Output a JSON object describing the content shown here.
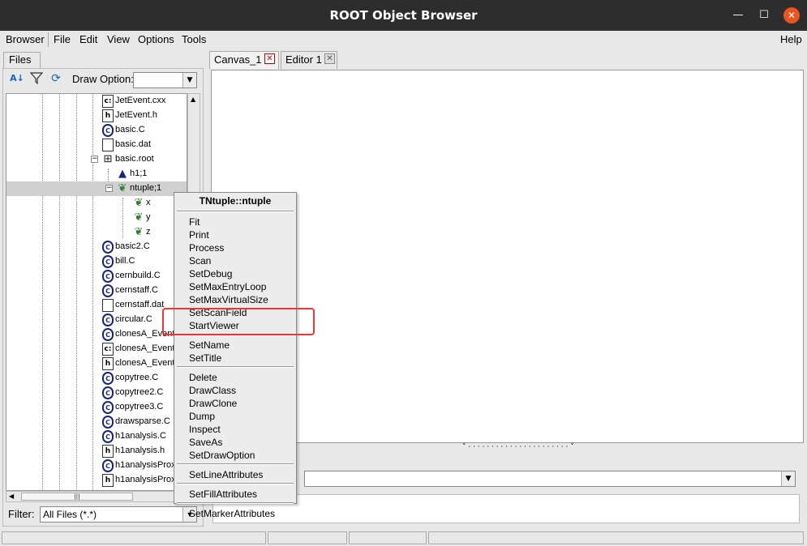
{
  "window": {
    "title": "ROOT Object Browser",
    "min_glyph": "—",
    "max_glyph": "☐",
    "close_glyph": "✕"
  },
  "menubar": {
    "browser": "Browser",
    "file": "File",
    "edit": "Edit",
    "view": "View",
    "options": "Options",
    "tools": "Tools",
    "help": "Help"
  },
  "left": {
    "tab_files": "Files",
    "draw_option_label": "Draw Option:",
    "draw_option_value": "",
    "filter_label": "Filter:",
    "filter_value": "All Files (*.*)",
    "tree": [
      {
        "label": "JetEvent.cxx",
        "icon": "c-source-icon",
        "glyph": "c:"
      },
      {
        "label": "JetEvent.h",
        "icon": "header-file-icon",
        "glyph": "h"
      },
      {
        "label": "basic.C",
        "icon": "macro-file-icon",
        "glyph": "C"
      },
      {
        "label": "basic.dat",
        "icon": "text-file-icon",
        "glyph": ""
      },
      {
        "label": "basic.root",
        "icon": "root-file-icon",
        "glyph": "⊞"
      },
      {
        "label": "h1;1",
        "icon": "histogram-icon",
        "glyph": "▲"
      },
      {
        "label": "ntuple;1",
        "icon": "ntuple-icon",
        "glyph": "❦"
      },
      {
        "label": "x",
        "icon": "leaf-icon",
        "glyph": "❦"
      },
      {
        "label": "y",
        "icon": "leaf-icon",
        "glyph": "❦"
      },
      {
        "label": "z",
        "icon": "leaf-icon",
        "glyph": "❦"
      },
      {
        "label": "basic2.C",
        "icon": "macro-file-icon",
        "glyph": "C"
      },
      {
        "label": "bill.C",
        "icon": "macro-file-icon",
        "glyph": "C"
      },
      {
        "label": "cernbuild.C",
        "icon": "macro-file-icon",
        "glyph": "C"
      },
      {
        "label": "cernstaff.C",
        "icon": "macro-file-icon",
        "glyph": "C"
      },
      {
        "label": "cernstaff.dat",
        "icon": "text-file-icon",
        "glyph": ""
      },
      {
        "label": "circular.C",
        "icon": "macro-file-icon",
        "glyph": "C"
      },
      {
        "label": "clonesA_Event",
        "icon": "macro-file-icon",
        "glyph": "C"
      },
      {
        "label": "clonesA_Event.",
        "icon": "c-source-icon",
        "glyph": "c:"
      },
      {
        "label": "clonesA_Event.",
        "icon": "header-file-icon",
        "glyph": "h"
      },
      {
        "label": "copytree.C",
        "icon": "macro-file-icon",
        "glyph": "C"
      },
      {
        "label": "copytree2.C",
        "icon": "macro-file-icon",
        "glyph": "C"
      },
      {
        "label": "copytree3.C",
        "icon": "macro-file-icon",
        "glyph": "C"
      },
      {
        "label": "drawsparse.C",
        "icon": "macro-file-icon",
        "glyph": "C"
      },
      {
        "label": "h1analysis.C",
        "icon": "macro-file-icon",
        "glyph": "C"
      },
      {
        "label": "h1analysis.h",
        "icon": "header-file-icon",
        "glyph": "h"
      },
      {
        "label": "h1analysisProxy",
        "icon": "macro-file-icon",
        "glyph": "C"
      },
      {
        "label": "h1analysisProxy",
        "icon": "header-file-icon",
        "glyph": "h"
      }
    ]
  },
  "right": {
    "tab_canvas": "Canvas_1",
    "tab_editor": "Editor 1",
    "tab_close_glyph": "✕",
    "command_value": ""
  },
  "context_menu": {
    "header": "TNtuple::ntuple",
    "group1": [
      "Fit",
      "Print",
      "Process",
      "Scan",
      "SetDebug",
      "SetMaxEntryLoop",
      "SetMaxVirtualSize",
      "SetScanField",
      "StartViewer"
    ],
    "group2": [
      "SetName",
      "SetTitle"
    ],
    "group3": [
      "Delete",
      "DrawClass",
      "DrawClone",
      "Dump",
      "Inspect",
      "SaveAs",
      "SetDrawOption"
    ],
    "group4": [
      "SetLineAttributes"
    ],
    "group5": [
      "SetFillAttributes"
    ],
    "group6": [
      "SetMarkerAttributes"
    ]
  },
  "colors": {
    "titlebar": "#2d2d2d",
    "close_button": "#e95420",
    "highlight_box": "#e53935",
    "selected_row": "#d0d0d0"
  }
}
